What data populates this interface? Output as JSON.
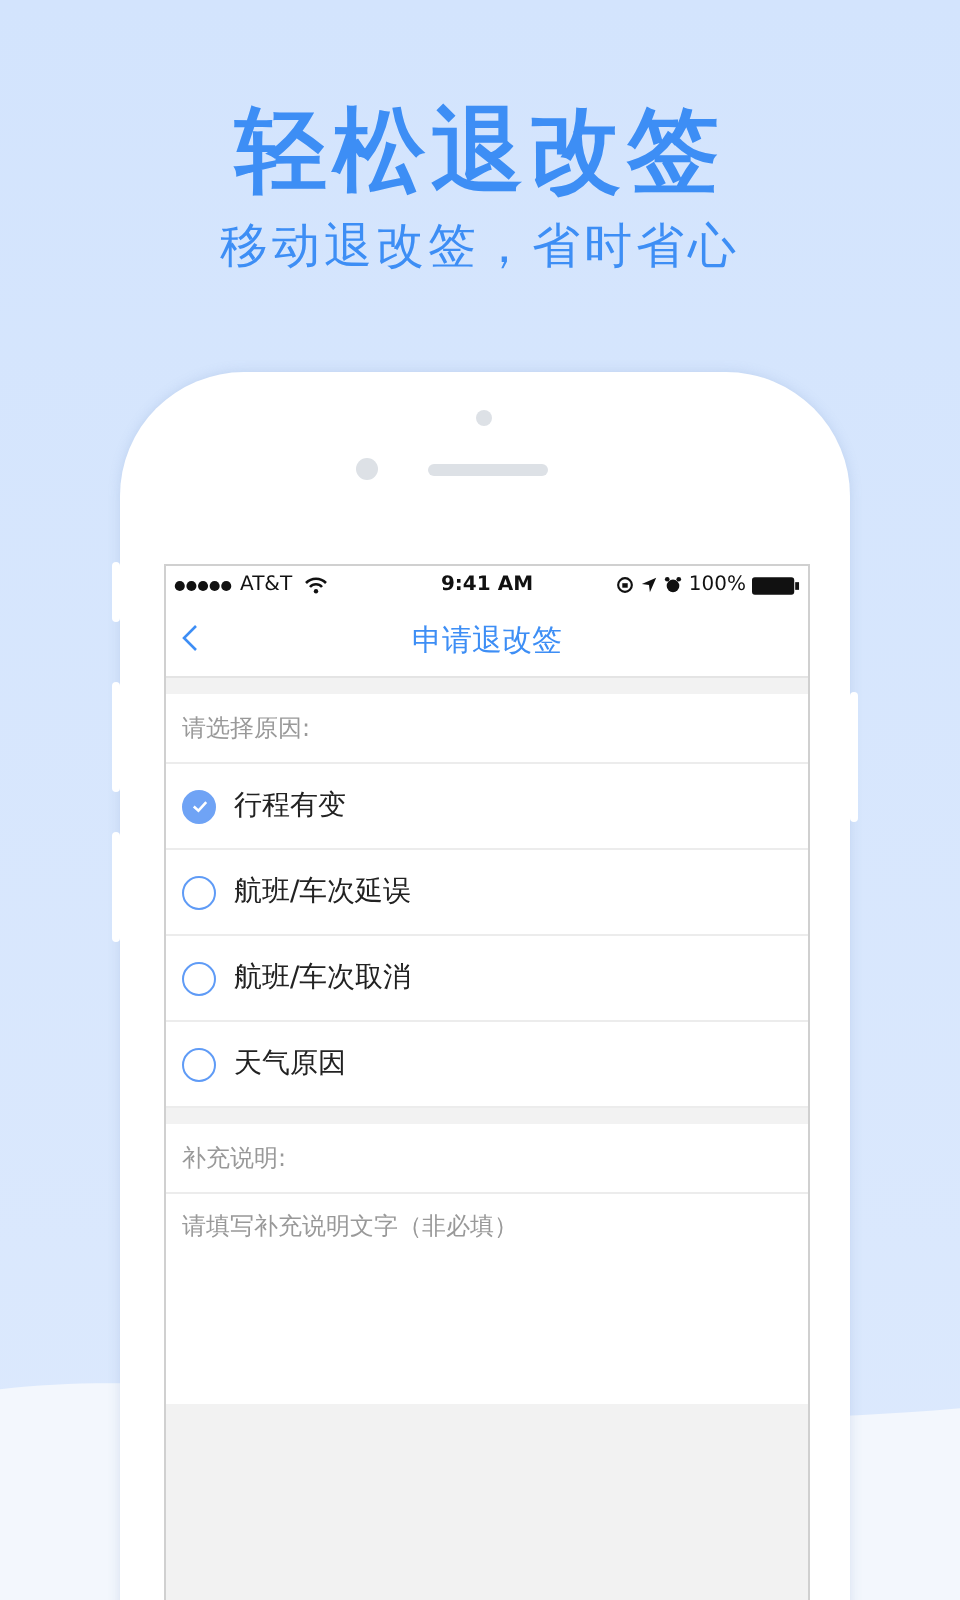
{
  "headline": "轻松退改签",
  "subtitle": "移动退改签，省时省心",
  "status_bar": {
    "carrier": "AT&T",
    "time": "9:41 AM",
    "battery": "100%"
  },
  "nav": {
    "title": "申请退改签"
  },
  "reason_label": "请选择原因:",
  "options": [
    {
      "label": "行程有变",
      "selected": true
    },
    {
      "label": "航班/车次延误",
      "selected": false
    },
    {
      "label": "航班/车次取消",
      "selected": false
    },
    {
      "label": "天气原因",
      "selected": false
    }
  ],
  "note_label": "补充说明:",
  "note": {
    "placeholder": "请填写补充说明文字（非必填）"
  }
}
